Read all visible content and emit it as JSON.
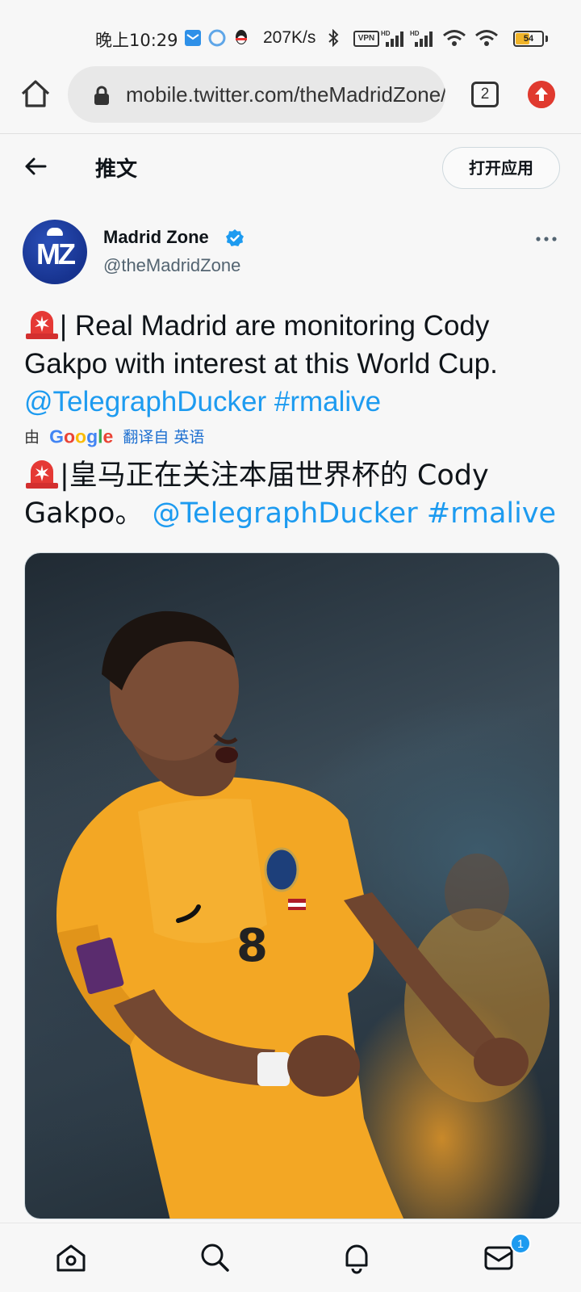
{
  "status_bar": {
    "time": "晚上10:29",
    "network_speed": "207K/s",
    "vpn": "VPN",
    "battery_level": 54,
    "battery_label": "54"
  },
  "browser": {
    "url": "mobile.twitter.com/theMadridZone/status",
    "tab_count": "2"
  },
  "header": {
    "title": "推文",
    "open_app": "打开应用"
  },
  "tweet": {
    "avatar_text": "MZ",
    "display_name": "Madrid Zone",
    "handle": "@theMadridZone",
    "text_main": "| Real Madrid are monitoring Cody Gakpo with interest at this World Cup.",
    "mention": "@TelegraphDucker",
    "hashtag": "#rmalive",
    "translate_prefix": "由",
    "translate_brand": "Google",
    "translate_link": "翻译自 英语",
    "translated_main": "|皇马正在关注本届世界杯的 Cody Gakpo。",
    "translated_mention": "@TelegraphDucker",
    "translated_hashtag": "#rmalive"
  },
  "bottom_nav": {
    "messages_badge": "1"
  },
  "colors": {
    "link": "#1d9bf0",
    "verified": "#1d9bf0",
    "upload_button": "#e03a2f",
    "jersey": "#f3a724"
  },
  "icons": [
    "home-icon",
    "lock-icon",
    "tabs-icon",
    "upload-icon",
    "back-arrow-icon",
    "verified-badge-icon",
    "more-icon",
    "siren-icon",
    "home-nav-icon",
    "search-icon",
    "notifications-icon",
    "messages-icon"
  ]
}
